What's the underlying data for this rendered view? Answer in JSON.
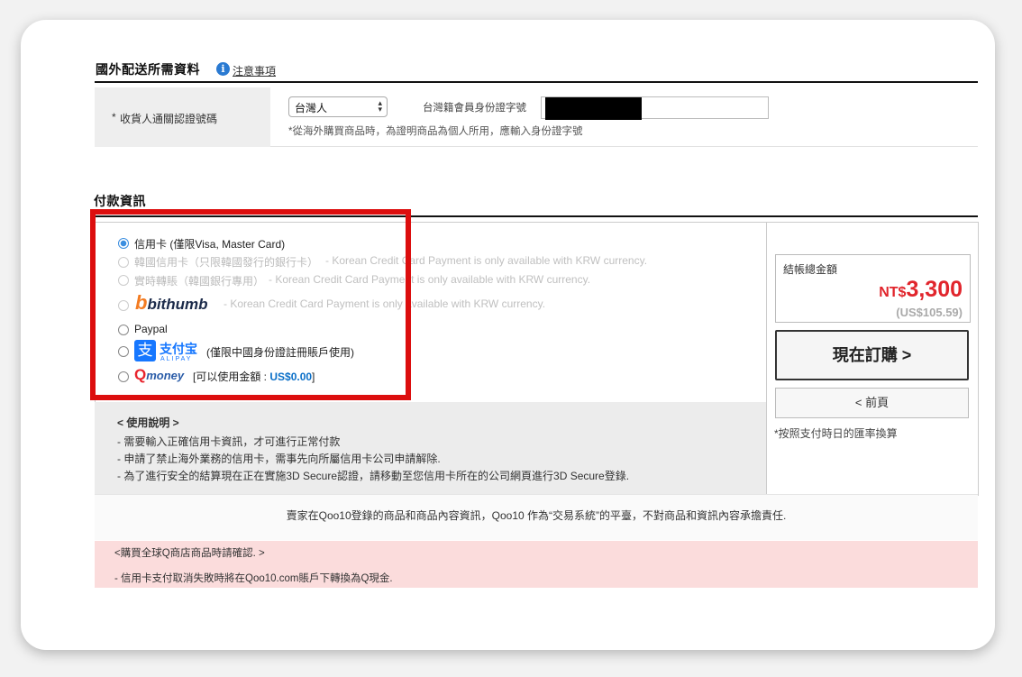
{
  "overseas": {
    "title": "國外配送所需資料",
    "info_icon": "i",
    "notice_link": "注意事項",
    "row_label_req": "*",
    "row_label": "收貨人通關認證號碼",
    "nationality_select": "台灣人",
    "id_label": "台灣籍會員身份證字號",
    "id_note": "*從海外購買商品時，為證明商品為個人所用，應輸入身份證字號"
  },
  "payment": {
    "title": "付款資訊",
    "options": [
      {
        "label": "信用卡 (僅限Visa, Master Card)",
        "selected": true,
        "disabled": false
      },
      {
        "label": "韓國信用卡（只限韓國發行的銀行卡）",
        "note": "- Korean Credit Card Payment is only available with KRW currency.",
        "disabled": true
      },
      {
        "label": "實時轉賬（韓國銀行專用）",
        "note": "- Korean Credit Card Payment is only available with KRW currency.",
        "disabled": true
      },
      {
        "label": "bithumb",
        "note": "- Korean Credit Card Payment is only available with KRW currency.",
        "disabled": true
      },
      {
        "label": "Paypal",
        "disabled": false
      },
      {
        "label": "(僅限中國身份證註冊賬戶使用)",
        "disabled": false
      },
      {
        "label": "[可以使用金額 : ",
        "amount": "US$0.00",
        "suffix": "]",
        "disabled": false
      }
    ],
    "bithumb_logo_b": "b",
    "bithumb_logo_text": "bithumb",
    "alipay_logo_char": "支",
    "alipay_logo_text": "支付宝",
    "alipay_logo_sub": "ALIPAY",
    "qmoney_q": "Q",
    "qmoney_text": "money",
    "usage": {
      "title": "< 使用說明 >",
      "lines": [
        "- 需要輸入正確信用卡資訊，才可進行正常付款",
        "- 申請了禁止海外業務的信用卡，需事先向所屬信用卡公司申請解除.",
        "- 為了進行安全的結算現在正在實施3D Secure認證，請移動至您信用卡所在的公司網頁進行3D Secure登錄."
      ]
    }
  },
  "summary": {
    "total_label": "結帳總金額",
    "currency": "NT$",
    "total": "3,300",
    "usd": "(US$105.59)",
    "order_button": "現在訂購  >",
    "prev_button": "< 前頁",
    "rate_note": "*按照支付時日的匯率換算"
  },
  "footer": {
    "disclaimer": "賣家在Qoo10登錄的商品和商品內容資訊，Qoo10 作為“交易系統”的平臺，不對商品和資訊內容承擔責任.",
    "pink_title": "<購買全球Q商店商品時請確認. >",
    "pink_line": "- 信用卡支付取消失敗時將在Qoo10.com賬戶下轉換為Q現金."
  },
  "colors": {
    "highlight": "#dc0e0e",
    "price": "#e1252c",
    "selected_radio": "#3b8ee0",
    "pink_bg": "#fbdcdc"
  }
}
